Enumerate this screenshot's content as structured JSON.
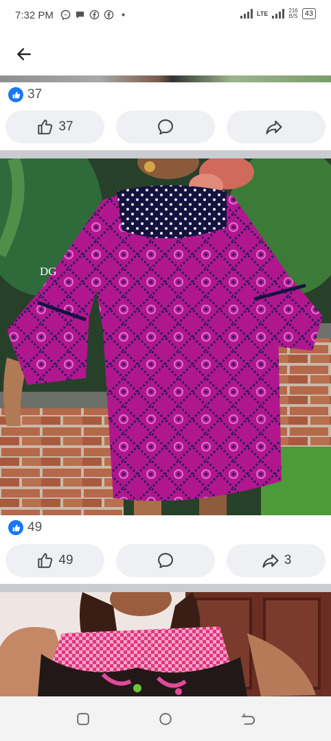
{
  "status_bar": {
    "time": "7:32 PM",
    "network": "LTE",
    "speed_value": "216",
    "speed_unit": "B/S",
    "battery": "43",
    "notification_icons": [
      "messenger-icon",
      "chat-icon",
      "facebook-icon",
      "facebook-icon",
      "more-dot-icon"
    ]
  },
  "header": {
    "back_icon": "arrow-left-icon"
  },
  "posts": [
    {
      "reactions": "37",
      "like_label": "37",
      "share_label": ""
    },
    {
      "reactions": "49",
      "like_label": "49",
      "share_label": "3",
      "watermark": "DG"
    },
    {
      "reactions": "",
      "like_label": "",
      "share_label": ""
    }
  ],
  "colors": {
    "accent": "#1877f2",
    "pill_bg": "#eef0f3",
    "divider": "#c9ccd1",
    "dress_magenta": "#b0178f"
  },
  "system_nav": {
    "icons": [
      "recents-icon",
      "home-icon",
      "back-icon"
    ]
  }
}
